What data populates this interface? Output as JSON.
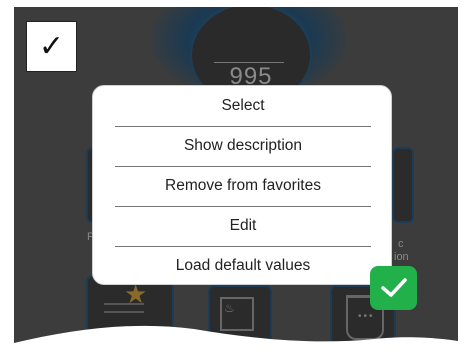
{
  "background": {
    "gauge_value": "995",
    "captions": [
      "F",
      "c",
      "ion"
    ]
  },
  "check_button": {
    "glyph": "✓",
    "icon": "checkmark-icon"
  },
  "menu": {
    "items": [
      {
        "label": "Select"
      },
      {
        "label": "Show description"
      },
      {
        "label": "Remove from favorites"
      },
      {
        "label": "Edit"
      },
      {
        "label": "Load default values"
      }
    ]
  },
  "confirm_button": {
    "icon": "checkmark-icon",
    "color": "#22b04b"
  },
  "colors": {
    "overlay": "#3c3c3c",
    "menu_bg": "#ffffff",
    "accent_ring": "#1c3c55"
  }
}
